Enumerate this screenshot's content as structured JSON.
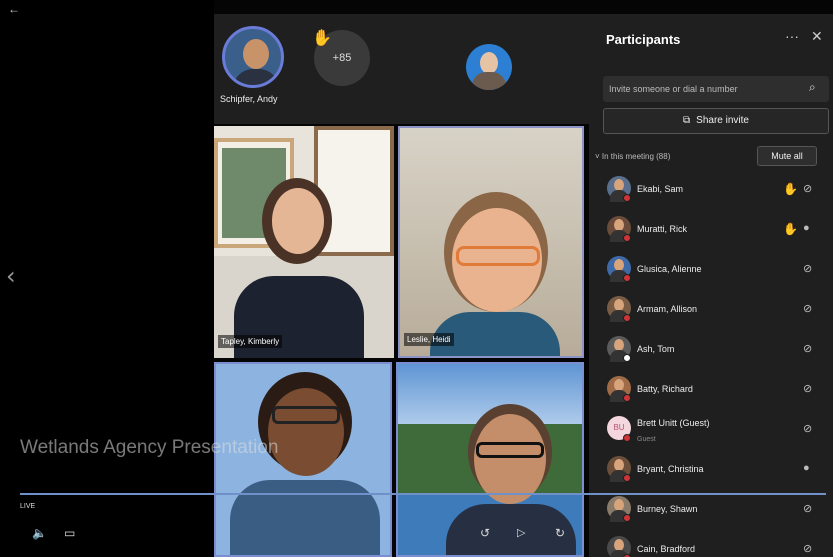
{
  "top_strip": {
    "featured_name": "Schipfer, Andy",
    "more_count": "+85"
  },
  "tiles": {
    "tile1_name": "Tapley, Kimberly",
    "tile2_name": "Leslie, Heidi"
  },
  "panel": {
    "title": "Participants",
    "more_glyph": "···",
    "close_glyph": "✕",
    "invite_placeholder": "Invite someone or dial a number",
    "share_invite_label": "Share invite",
    "section_label": "˅ In this meeting (88)",
    "mute_all_label": "Mute all",
    "participants": [
      {
        "name": "Ekabi, Sam",
        "hand": true,
        "status_color": "#d13438",
        "mic": "off"
      },
      {
        "name": "Muratti, Rick",
        "hand": true,
        "status_color": "#d13438",
        "mic": "on"
      },
      {
        "name": "Glusica, Alienne",
        "hand": false,
        "status_color": "#d13438",
        "mic": "off"
      },
      {
        "name": "Armam, Allison",
        "hand": false,
        "status_color": "#d13438",
        "mic": "off"
      },
      {
        "name": "Ash, Tom",
        "hand": false,
        "status_color": "#ffffff",
        "mic": "off"
      },
      {
        "name": "Batty, Richard",
        "hand": false,
        "status_color": "#d13438",
        "mic": "off"
      },
      {
        "name": "Brett Unitt (Guest)",
        "sub": "Guest",
        "initials": "BU",
        "hand": false,
        "status_color": "#d13438",
        "mic": "off"
      },
      {
        "name": "Bryant, Christina",
        "hand": false,
        "status_color": "#d13438",
        "mic": "on"
      },
      {
        "name": "Burney, Shawn",
        "hand": false,
        "status_color": "#d13438",
        "mic": "off"
      },
      {
        "name": "Cain, Bradford",
        "hand": false,
        "status_color": "#d13438",
        "mic": "off"
      }
    ]
  },
  "overlay": {
    "presentation_title": "Wetlands Agency Presentation",
    "live_label": "LIVE"
  },
  "icons": {
    "back": "arrow-left-icon",
    "prev": "chevron-left-icon",
    "search": "search-icon",
    "share": "share-icon",
    "hand": "raised-hand-icon",
    "mic_off": "mic-off-icon",
    "mic_on": "mic-icon",
    "volume": "volume-icon",
    "captions": "captions-icon",
    "rewind": "rewind-icon",
    "play": "play-icon",
    "forward": "forward-icon"
  },
  "colors": {
    "accent": "#6a7bd8",
    "hand": "#f1b434",
    "busy": "#d13438",
    "panel_bg": "#1f1f1f"
  }
}
